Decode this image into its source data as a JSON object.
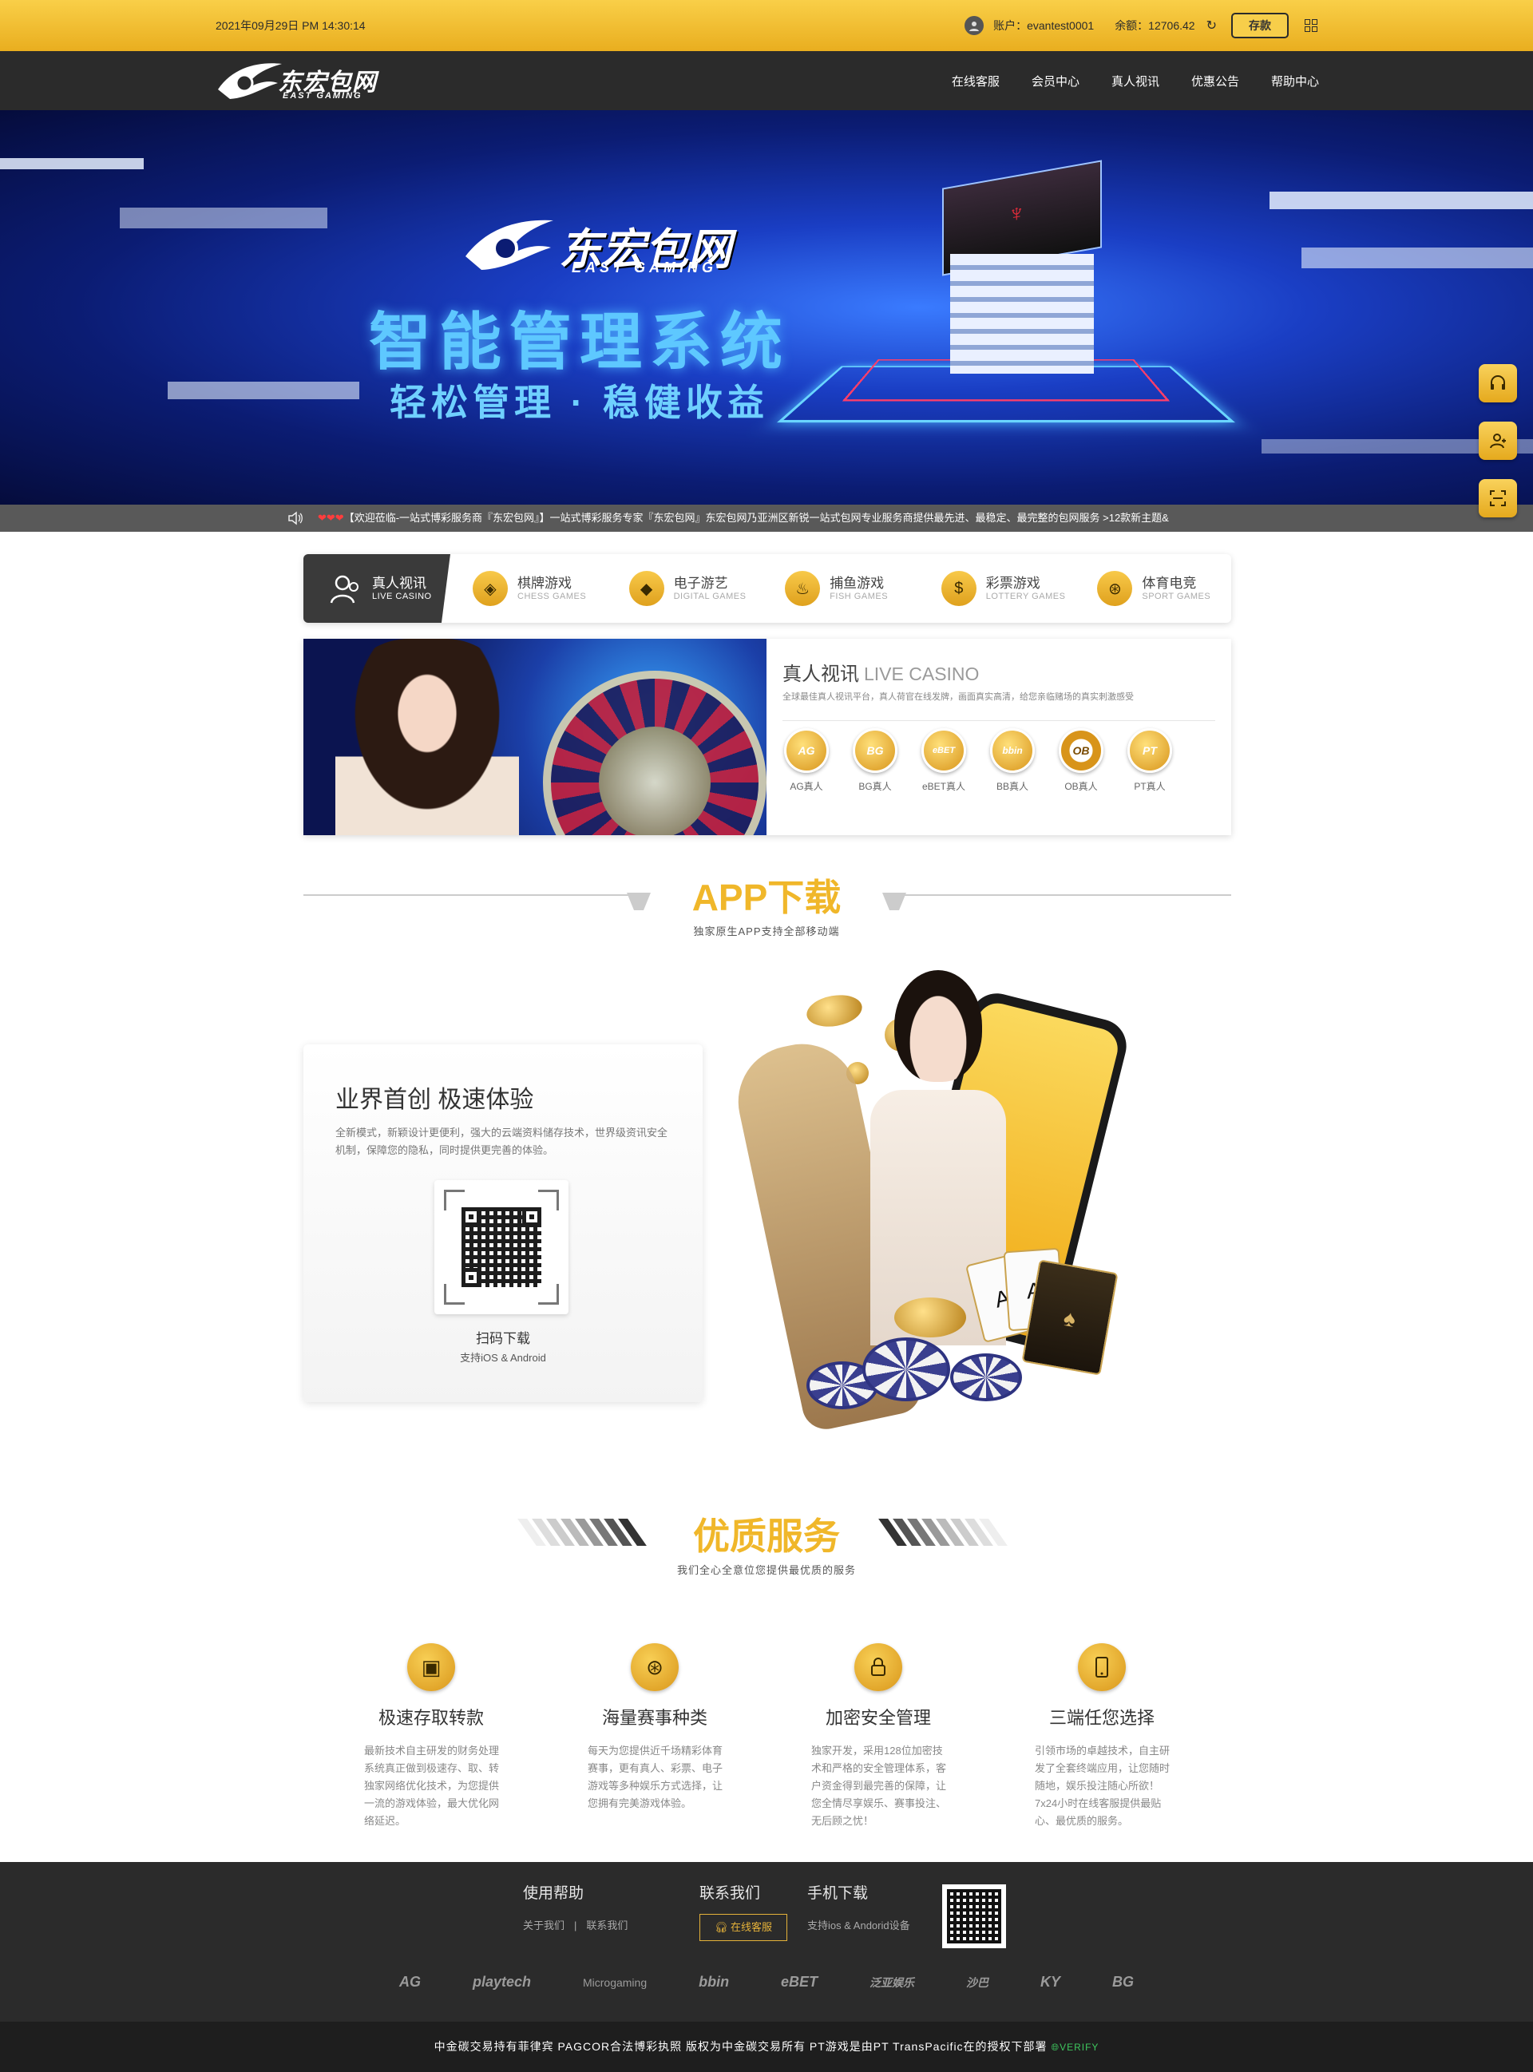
{
  "topbar": {
    "datetime": "2021年09月29日 PM 14:30:14",
    "account_label": "账户：evantest0001",
    "balance_label": "余额：12706.42",
    "deposit_button": "存款",
    "refresh_icon": "refresh-icon",
    "menu_icon": "grid-icon"
  },
  "nav": {
    "logo_cn": "东宏包网",
    "logo_en": "EAST GAMING",
    "items": [
      "在线客服",
      "会员中心",
      "真人视讯",
      "优惠公告",
      "帮助中心"
    ]
  },
  "banner": {
    "logo_cn": "东宏包网",
    "logo_en": "EAST GAMING",
    "title": "智能管理系统",
    "subtitle": "轻松管理 · 稳健收益"
  },
  "marquee": {
    "hearts": "❤❤❤",
    "text": "【欢迎莅临-一站式博彩服务商『东宏包网』】一站式博彩服务专家『东宏包网』东宏包网乃亚洲区新锐一站式包网专业服务商提供最先进、最稳定、最完整的包网服务 >12款新主题&"
  },
  "tabs": [
    {
      "label": "真人视讯",
      "sub": "LIVE CASINO",
      "icon": "user-icon"
    },
    {
      "label": "棋牌游戏",
      "sub": "CHESS GAMES",
      "icon": "chess-icon"
    },
    {
      "label": "电子游艺",
      "sub": "DIGITAL GAMES",
      "icon": "diamond-icon"
    },
    {
      "label": "捕鱼游戏",
      "sub": "FISH GAMES",
      "icon": "fish-icon"
    },
    {
      "label": "彩票游戏",
      "sub": "LOTTERY GAMES",
      "icon": "dollar-icon"
    },
    {
      "label": "体育电竞",
      "sub": "SPORT GAMES",
      "icon": "ball-icon"
    }
  ],
  "live": {
    "title": "真人视讯",
    "title_en": "LIVE CASINO",
    "description": "全球最佳真人视讯平台，真人荷官在线发牌，画面真实高清，给您亲临赌场的真实刺激感受",
    "providers": [
      {
        "logo": "AG",
        "label": "AG真人"
      },
      {
        "logo": "BG",
        "label": "BG真人"
      },
      {
        "logo": "eBET",
        "label": "eBET真人"
      },
      {
        "logo": "bbin",
        "label": "BB真人"
      },
      {
        "logo": "OB",
        "label": "OB真人"
      },
      {
        "logo": "PT",
        "label": "PT真人"
      }
    ]
  },
  "app": {
    "heading": "APP下载",
    "sub": "独家原生APP支持全部移动端",
    "card_title": "业界首创 极速体验",
    "card_desc": "全新模式，新颖设计更便利，强大的云端资料储存技术，世界级资讯安全机制，保障您的隐私，同时提供更完善的体验。",
    "qr_title": "扫码下载",
    "qr_sub": "支持iOS & Android"
  },
  "service": {
    "heading": "优质服务",
    "sub": "我们全心全意位您提供最优质的服务",
    "items": [
      {
        "icon": "wallet-icon",
        "title": "极速存取转款",
        "desc": "最新技术自主研发的财务处理系统真正做到极速存、取、转独家网络优化技术，为您提供一流的游戏体验，最大优化网络延迟。"
      },
      {
        "icon": "basketball-icon",
        "title": "海量赛事种类",
        "desc": "每天为您提供近千场精彩体育赛事，更有真人、彩票、电子游戏等多种娱乐方式选择，让您拥有完美游戏体验。"
      },
      {
        "icon": "lock-icon",
        "title": "加密安全管理",
        "desc": "独家开发，采用128位加密技术和严格的安全管理体系，客户资金得到最完善的保障，让您全情尽享娱乐、赛事投注、无后顾之忧！"
      },
      {
        "icon": "phone-icon",
        "title": "三端任您选择",
        "desc": "引领市场的卓越技术，自主研发了全套终端应用，让您随时随地，娱乐投注随心所欲！7x24小时在线客服提供最贴心、最优质的服务。"
      }
    ]
  },
  "footer": {
    "help_title": "使用帮助",
    "help_links": [
      "关于我们",
      "联系我们"
    ],
    "contact_title": "联系我们",
    "contact_button": "在线客服",
    "mobile_title": "手机下载",
    "mobile_desc": "支持ios & Andorid设备",
    "partners": [
      "AG",
      "playtech",
      "Microgaming",
      "bbin",
      "eBET",
      "泛亚娱乐",
      "沙巴",
      "KY",
      "BG"
    ]
  },
  "copyright": {
    "text": "中金碳交易持有菲律宾 PAGCOR合法博彩执照 版权为中金碳交易所有 PT游戏是由PT TransPacific在的授权下部署",
    "verify": "VERIFY"
  },
  "side_buttons": [
    "headset-icon",
    "user-icon",
    "scan-icon"
  ]
}
